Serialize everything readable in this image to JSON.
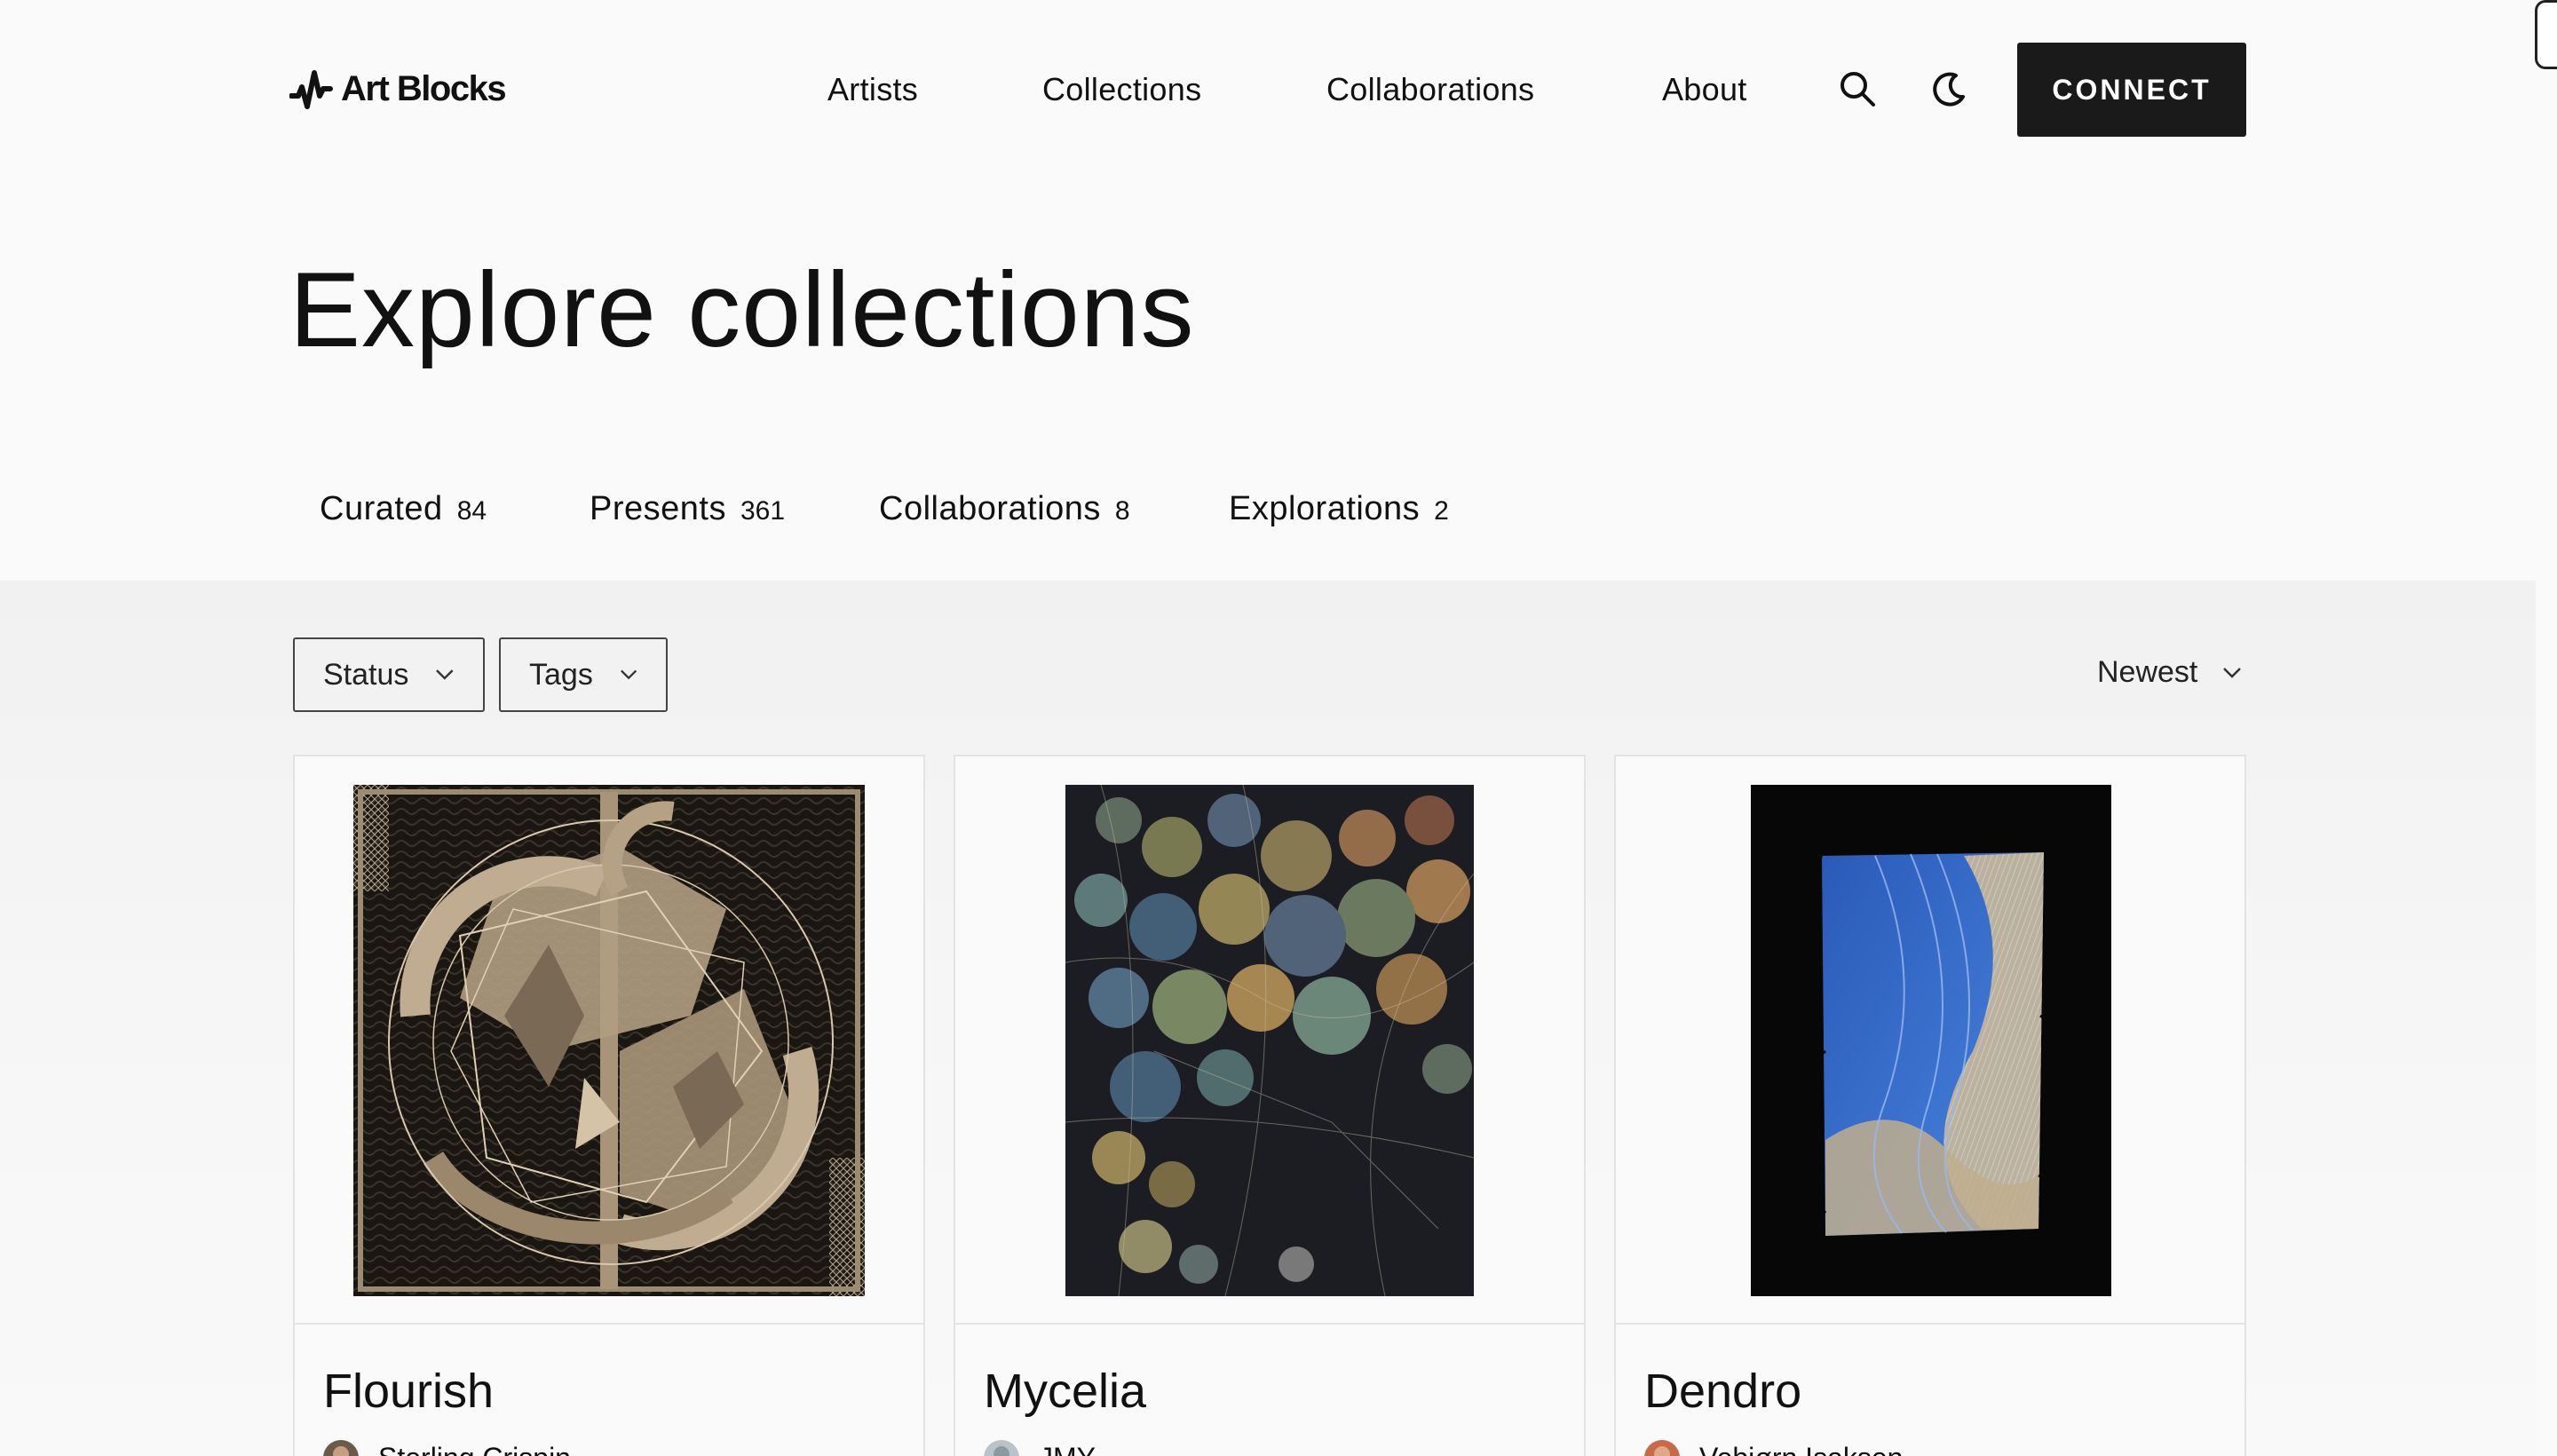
{
  "header": {
    "logo_text": "Art Blocks",
    "nav": [
      "Artists",
      "Collections",
      "Collaborations",
      "About"
    ],
    "search_icon": "search-icon",
    "theme_icon": "moon-icon",
    "connect_label": "CONNECT"
  },
  "page": {
    "title": "Explore collections"
  },
  "tabs": [
    {
      "label": "Curated",
      "count": "84"
    },
    {
      "label": "Presents",
      "count": "361"
    },
    {
      "label": "Collaborations",
      "count": "8"
    },
    {
      "label": "Explorations",
      "count": "2"
    }
  ],
  "filters": {
    "status_label": "Status",
    "tags_label": "Tags",
    "sort_label": "Newest"
  },
  "cards": [
    {
      "title": "Flourish",
      "artist": "Sterling Crispin"
    },
    {
      "title": "Mycelia",
      "artist": "JMY"
    },
    {
      "title": "Dendro",
      "artist": "Vebjørn Isaksen"
    }
  ],
  "colors": {
    "background": "#fafafa",
    "band": "#f2f2f2",
    "button_dark": "#1a1a1a",
    "accent_blue": "#3a6fd0"
  }
}
